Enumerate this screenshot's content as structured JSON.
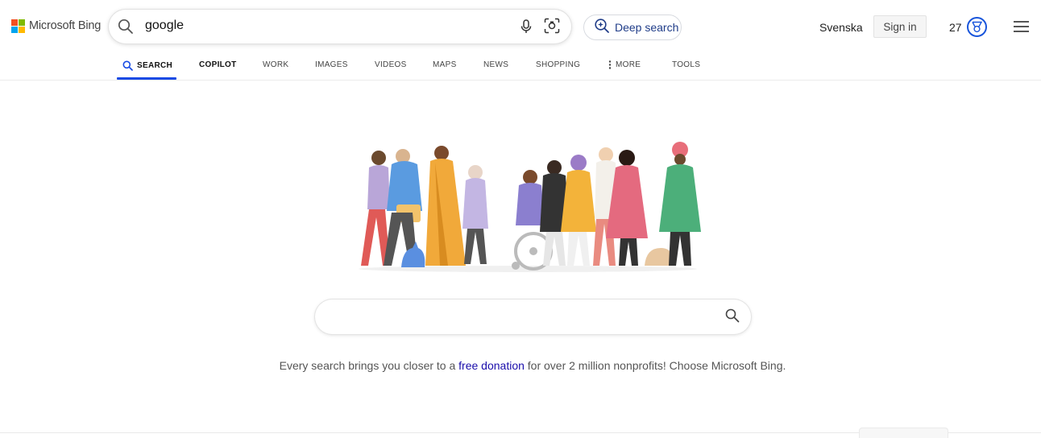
{
  "logo": {
    "text": "Microsoft Bing",
    "colors": [
      "#f25022",
      "#7fba00",
      "#00a4ef",
      "#ffb900"
    ]
  },
  "search": {
    "query": "google"
  },
  "deep_search": {
    "label": "Deep search"
  },
  "header": {
    "language": "Svenska",
    "sign_in": "Sign in",
    "points": "27"
  },
  "nav": {
    "tabs": [
      {
        "label": "SEARCH",
        "icon": "search-icon",
        "active": true
      },
      {
        "label": "COPILOT"
      },
      {
        "label": "WORK"
      },
      {
        "label": "IMAGES"
      },
      {
        "label": "VIDEOS"
      },
      {
        "label": "MAPS"
      },
      {
        "label": "NEWS"
      },
      {
        "label": "SHOPPING"
      },
      {
        "label": "MORE",
        "icon": "more-dots-icon"
      },
      {
        "label": "TOOLS"
      }
    ]
  },
  "center_search": {
    "value": ""
  },
  "promo": {
    "before": "Every search brings you closer to a ",
    "link": "free donation",
    "after": " for over 2 million nonprofits! Choose Microsoft Bing."
  },
  "colors": {
    "accent": "#174ae4",
    "link": "#1a0dab"
  }
}
